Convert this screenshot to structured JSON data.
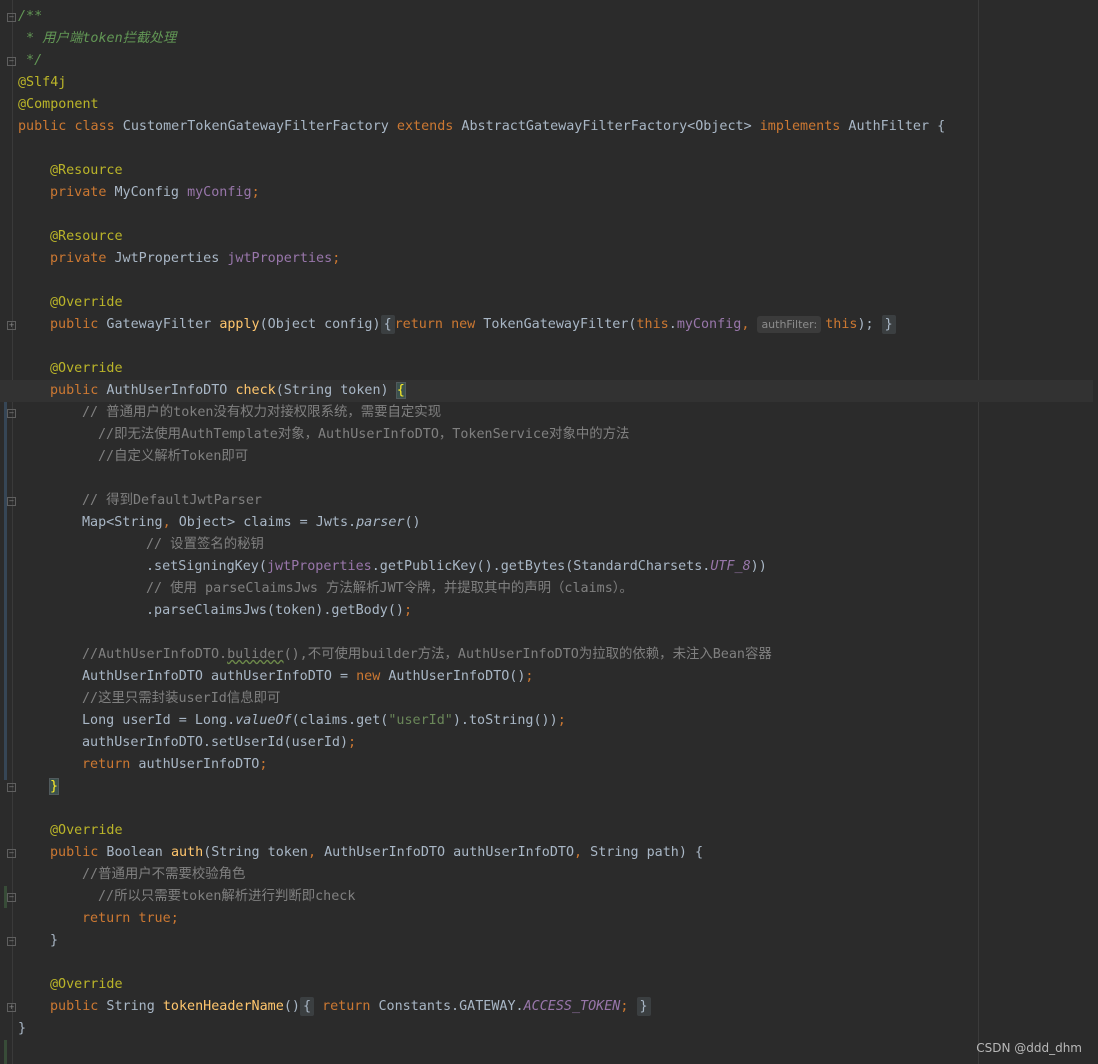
{
  "editor": {
    "theme": "darcula",
    "colors": {
      "background": "#2b2b2b",
      "keyword": "#cc7832",
      "annotation": "#bbb529",
      "method": "#ffc66d",
      "field": "#9876aa",
      "string": "#6a8759",
      "comment": "#808080",
      "doc_comment": "#629755"
    }
  },
  "code": {
    "l1": "/**",
    "l2": " * 用户端token拦截处理",
    "l3": " */",
    "l4": "@Slf4j",
    "l5": "@Component",
    "l6_public": "public",
    "l6_class": "class",
    "l6_name": " CustomerTokenGatewayFilterFactory ",
    "l6_extends": "extends",
    "l6_parent": " AbstractGatewayFilterFactory<Object> ",
    "l6_implements": "implements",
    "l6_iface": " AuthFilter {",
    "resource": "@Resource",
    "private": "private",
    "myconfig_type": " MyConfig ",
    "myconfig_field": "myConfig",
    "semi": ";",
    "jwt_type": " JwtProperties ",
    "jwt_field": "jwtProperties",
    "override": "@Override",
    "public": "public",
    "apply_ret": " GatewayFilter ",
    "apply_name": "apply",
    "apply_params": "(Object config)",
    "fold_open": "{",
    "return": "return",
    "new": "new",
    "apply_ctor": " TokenGatewayFilter(",
    "this": "this",
    "dot": ".",
    "comma_space": ", ",
    "hint_authfilter": "authFilter:",
    "close_paren_semi": ");",
    "fold_close": "}",
    "check_ret": " AuthUserInfoDTO ",
    "check_name": "check",
    "check_params": "(String token) ",
    "brace_open": "{",
    "c1": "// 普通用户的token没有权力对接权限系统，需要自定实现",
    "c2": "//即无法使用AuthTemplate对象，AuthUserInfoDTO，TokenService对象中的方法",
    "c3": "//自定义解析Token即可",
    "c4": "// 得到DefaultJwtParser",
    "claims_decl": "Map<String",
    "claims_decl2": " Object> claims = Jwts.",
    "parser": "parser",
    "parens": "()",
    "c5": "// 设置签名的秘钥",
    "set_key1": ".setSigningKey(",
    "set_key2": ".getPublicKey().getBytes(StandardCharsets.",
    "utf8": "UTF_8",
    "set_key3": "))",
    "c6": "// 使用 parseClaimsJws 方法解析JWT令牌，并提取其中的声明（claims）。",
    "parse_claims": ".parseClaimsJws(token).getBody()",
    "c7a": "//AuthUserInfoDTO.",
    "c7b": "bulider",
    "c7c": "(),不可使用builder方法，AuthUserInfoDTO为拉取的依赖，未注入Bean容器",
    "dto_decl": "AuthUserInfoDTO authUserInfoDTO = ",
    "dto_ctor": " AuthUserInfoDTO()",
    "c8": "//这里只需封装userId信息即可",
    "uid1": "Long userId = Long.",
    "uid_valueof": "valueOf",
    "uid2": "(claims.get(",
    "uid_str": "\"userId\"",
    "uid3": ").toString())",
    "set_uid": "authUserInfoDTO.setUserId(userId)",
    "ret_dto": " authUserInfoDTO",
    "brace_close": "}",
    "auth_ret": " Boolean ",
    "auth_name": "auth",
    "auth_p1": "(String token",
    "auth_p2": " AuthUserInfoDTO authUserInfoDTO",
    "auth_p3": " String path) {",
    "comma": ",",
    "c9": "//普通用户不需要校验角色",
    "c10": "//所以只需要token解析进行判断即check",
    "true": "true",
    "thn_ret": " String ",
    "thn_name": "tokenHeaderName",
    "thn_call": " Constants.GATEWAY.",
    "access_token": "ACCESS_TOKEN",
    "class_close": "}"
  },
  "watermark": "CSDN @ddd_dhm"
}
